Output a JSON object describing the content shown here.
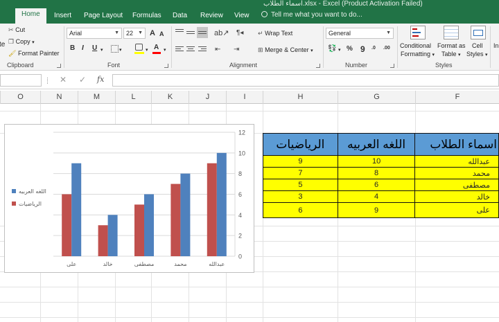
{
  "window": {
    "title": "اسماء الطلاب.xlsx - Excel (Product Activation Failed)"
  },
  "tabs": [
    {
      "label": "Home",
      "active": true
    },
    {
      "label": "Insert"
    },
    {
      "label": "Page Layout"
    },
    {
      "label": "Formulas"
    },
    {
      "label": "Data"
    },
    {
      "label": "Review"
    },
    {
      "label": "View"
    }
  ],
  "tell_me": "Tell me what you want to do...",
  "ribbon": {
    "clipboard": {
      "cut": "Cut",
      "copy": "Copy",
      "format_painter": "Format Painter",
      "paste_fragment": "te",
      "label": "Clipboard"
    },
    "font": {
      "name": "Arial",
      "size": "22",
      "bold": "B",
      "italic": "I",
      "underline": "U",
      "font_color": "A",
      "grow": "A",
      "shrink": "A",
      "label": "Font"
    },
    "alignment": {
      "wrap": "Wrap Text",
      "merge": "Merge & Center",
      "label": "Alignment"
    },
    "number": {
      "format": "General",
      "percent": "%",
      "comma": "9",
      "dec_inc": ".0",
      "dec_dec": ".00",
      "label": "Number"
    },
    "styles": {
      "conditional": "Conditional",
      "conditional2": "Formatting",
      "format_as": "Format as",
      "format_as2": "Table",
      "cell": "Cell",
      "cell2": "Styles",
      "label": "Styles",
      "insert_fragment": "In"
    }
  },
  "formula_bar": {
    "cancel": "✕",
    "enter": "✓",
    "fx": "fx",
    "value": ""
  },
  "columns": [
    "O",
    "N",
    "M",
    "L",
    "K",
    "J",
    "I",
    "H",
    "G",
    "F"
  ],
  "table": {
    "headers": [
      "الرياضيات",
      "اللغه العربيه",
      "اسماء الطلاب"
    ],
    "rows": [
      {
        "math": "9",
        "arabic": "10",
        "name": "عبدالله"
      },
      {
        "math": "7",
        "arabic": "8",
        "name": "محمد"
      },
      {
        "math": "5",
        "arabic": "6",
        "name": "مصطفى"
      },
      {
        "math": "3",
        "arabic": "4",
        "name": "خالد"
      },
      {
        "math": "6",
        "arabic": "9",
        "name": "على"
      }
    ]
  },
  "chart_data": {
    "type": "bar",
    "categories": [
      "على",
      "خالد",
      "مصطفى",
      "محمد",
      "عبدالله"
    ],
    "series": [
      {
        "name": "الرياضيات",
        "values": [
          6,
          3,
          5,
          7,
          9
        ],
        "color": "#c0504d"
      },
      {
        "name": "اللغه العربيه",
        "values": [
          9,
          4,
          6,
          8,
          10
        ],
        "color": "#4f81bd"
      }
    ],
    "ylim": [
      0,
      12
    ],
    "yticks": [
      "0",
      "2",
      "4",
      "6",
      "8",
      "10",
      "12"
    ],
    "grid": true,
    "legend": "left",
    "y_axis_side": "right"
  },
  "colors": {
    "excel_green": "#217346",
    "table_header": "#5b9bd5",
    "table_body": "#ffff00"
  }
}
